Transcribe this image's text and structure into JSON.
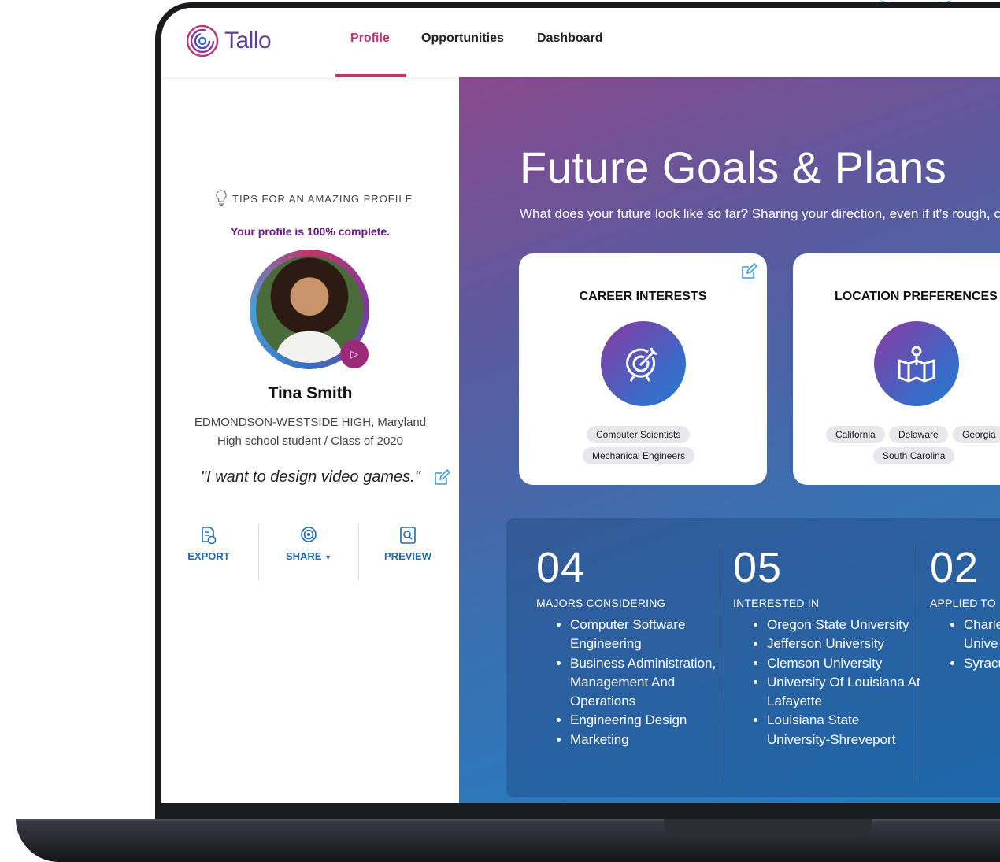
{
  "app": {
    "logo_text": "Tallo"
  },
  "nav": {
    "items": [
      {
        "label": "Profile",
        "active": true
      },
      {
        "label": "Opportunities",
        "active": false
      },
      {
        "label": "Dashboard",
        "active": false
      }
    ]
  },
  "profile": {
    "tips_label": "TIPS FOR AN AMAZING PROFILE",
    "completion": "Your profile is 100% complete.",
    "name": "Tina Smith",
    "school": "EDMONDSON-WESTSIDE HIGH, Maryland",
    "grade": "High school student / Class of 2020",
    "quote": "\"I want to design video games.\"",
    "actions": {
      "export": "EXPORT",
      "share": "SHARE",
      "preview": "PREVIEW"
    }
  },
  "goals": {
    "title": "Future Goals & Plans",
    "subtitle": "What does your future look like so far? Sharing your direction, even if it's rough, c",
    "cards": {
      "career": {
        "title": "CAREER INTERESTS",
        "chips": [
          "Computer Scientists",
          "Mechanical Engineers"
        ]
      },
      "location": {
        "title": "LOCATION PREFERENCES",
        "chips": [
          "California",
          "Delaware",
          "Georgia",
          "South Carolina"
        ]
      }
    },
    "stats": [
      {
        "number": "04",
        "caption": "MAJORS CONSIDERING",
        "items": [
          "Computer Software Engineering",
          "Business Administration, Management And Operations",
          "Engineering Design",
          "Marketing"
        ]
      },
      {
        "number": "05",
        "caption": "INTERESTED IN",
        "items": [
          "Oregon State University",
          "Jefferson University",
          "Clemson University",
          "University Of Louisiana At Lafayette",
          "Louisiana State University-Shreveport"
        ]
      },
      {
        "number": "02",
        "caption": "APPLIED TO",
        "items": [
          "Charle Unive",
          "Syracu"
        ]
      }
    ]
  },
  "colors": {
    "accent": "#c3336e",
    "link": "#1e6bb0",
    "completion": "#6a1a8c"
  }
}
